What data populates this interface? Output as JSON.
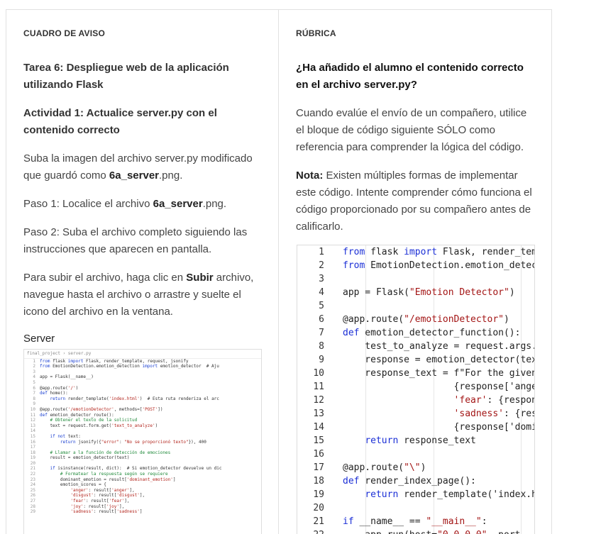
{
  "left": {
    "section_title": "CUADRO DE AVISO",
    "task_title": "Tarea 6: Despliegue web de la aplicación utilizando Flask",
    "activity_title": "Actividad 1: Actualice server.py con el contenido correcto",
    "p1_pre": "Suba la imagen del archivo server.py modificado que guardó como ",
    "p1_bold": "6a_server",
    "p1_post": ".png.",
    "p2_pre": "Paso 1: Localice el archivo ",
    "p2_bold": "6a_server",
    "p2_post": ".png.",
    "p3": "Paso 2: Suba el archivo completo siguiendo las instrucciones que aparecen en pantalla.",
    "p4_pre": "Para subir el archivo, haga clic en ",
    "p4_bold": "Subir",
    "p4_post": " archivo, navegue hasta el archivo o arrastre y suelte el icono del archivo en la ventana.",
    "server_label": "Server",
    "thumb": {
      "breadcrumb": "final_project › server.py",
      "lines": [
        {
          "n": "1",
          "t": "from flask import Flask, render_template, request, jsonify"
        },
        {
          "n": "2",
          "t": "from EmotionDetection.emotion_detection import emotion_detector  # Aju"
        },
        {
          "n": "3",
          "t": ""
        },
        {
          "n": "4",
          "t": "app = Flask(__name__)"
        },
        {
          "n": "5",
          "t": ""
        },
        {
          "n": "6",
          "t": "@app.route('/')"
        },
        {
          "n": "7",
          "t": "def home():"
        },
        {
          "n": "8",
          "t": "    return render_template('index.html')  # Esta ruta renderiza el arc"
        },
        {
          "n": "9",
          "t": ""
        },
        {
          "n": "10",
          "t": "@app.route('/emotionDetector', methods=['POST'])"
        },
        {
          "n": "11",
          "t": "def emotion_detector_route():"
        },
        {
          "n": "12",
          "t": "    # Obtener el texto de la solicitud"
        },
        {
          "n": "13",
          "t": "    text = request.form.get('text_to_analyze')"
        },
        {
          "n": "14",
          "t": ""
        },
        {
          "n": "15",
          "t": "    if not text:"
        },
        {
          "n": "16",
          "t": "        return jsonify({\"error\": \"No se proporcionó texto\"}), 400"
        },
        {
          "n": "17",
          "t": ""
        },
        {
          "n": "18",
          "t": "    # Llamar a la función de detección de emociones"
        },
        {
          "n": "19",
          "t": "    result = emotion_detector(text)"
        },
        {
          "n": "20",
          "t": ""
        },
        {
          "n": "21",
          "t": "    if isinstance(result, dict):  # Si emotion_detector devuelve un dic"
        },
        {
          "n": "22",
          "t": "        # Formatear la respuesta según se requiere"
        },
        {
          "n": "23",
          "t": "        dominant_emotion = result['dominant_emotion']"
        },
        {
          "n": "24",
          "t": "        emotion_scores = {"
        },
        {
          "n": "25",
          "t": "            'anger': result['anger'],"
        },
        {
          "n": "26",
          "t": "            'disgust': result['disgust'],"
        },
        {
          "n": "27",
          "t": "            'fear': result['fear'],"
        },
        {
          "n": "28",
          "t": "            'joy': result['joy'],"
        },
        {
          "n": "29",
          "t": "            'sadness': result['sadness']"
        }
      ]
    }
  },
  "right": {
    "section_title": "RÚBRICA",
    "question": "¿Ha añadido el alumno el contenido correcto en el archivo server.py?",
    "p1": "Cuando evalúe el envío de un compañero, utilice el bloque de código siguiente SÓLO como referencia para comprender la lógica del código.",
    "note_label": "Nota:",
    "note_text": " Existen múltiples formas de implementar este código. Intente comprender cómo funciona el código proporcionado por su compañero antes de calificarlo.",
    "code_lines": [
      {
        "n": "1",
        "t": "from flask import Flask, render_tem"
      },
      {
        "n": "2",
        "t": "from EmotionDetection.emotion_detec"
      },
      {
        "n": "3",
        "t": ""
      },
      {
        "n": "4",
        "t": "app = Flask(\"Emotion Detector\")"
      },
      {
        "n": "5",
        "t": ""
      },
      {
        "n": "6",
        "t": "@app.route(\"/emotionDetector\")"
      },
      {
        "n": "7",
        "t": "def emotion_detector_function():"
      },
      {
        "n": "8",
        "t": "    test_to_analyze = request.args."
      },
      {
        "n": "9",
        "t": "    response = emotion_detector(tex"
      },
      {
        "n": "10",
        "t": "    response_text = f\"For the given"
      },
      {
        "n": "11",
        "t": "                    {response['ange"
      },
      {
        "n": "12",
        "t": "                    'fear': {respon"
      },
      {
        "n": "13",
        "t": "                    'sadness': {res"
      },
      {
        "n": "14",
        "t": "                    {response['domi"
      },
      {
        "n": "15",
        "t": "    return response_text"
      },
      {
        "n": "16",
        "t": ""
      },
      {
        "n": "17",
        "t": "@app.route(\"\\\")"
      },
      {
        "n": "18",
        "t": "def render_index_page():"
      },
      {
        "n": "19",
        "t": "    return render_template('index.h"
      },
      {
        "n": "20",
        "t": ""
      },
      {
        "n": "21",
        "t": "if __name__ == \"__main__\":"
      },
      {
        "n": "22",
        "t": "    app.run(host=\"0.0.0.0\", port"
      }
    ]
  }
}
